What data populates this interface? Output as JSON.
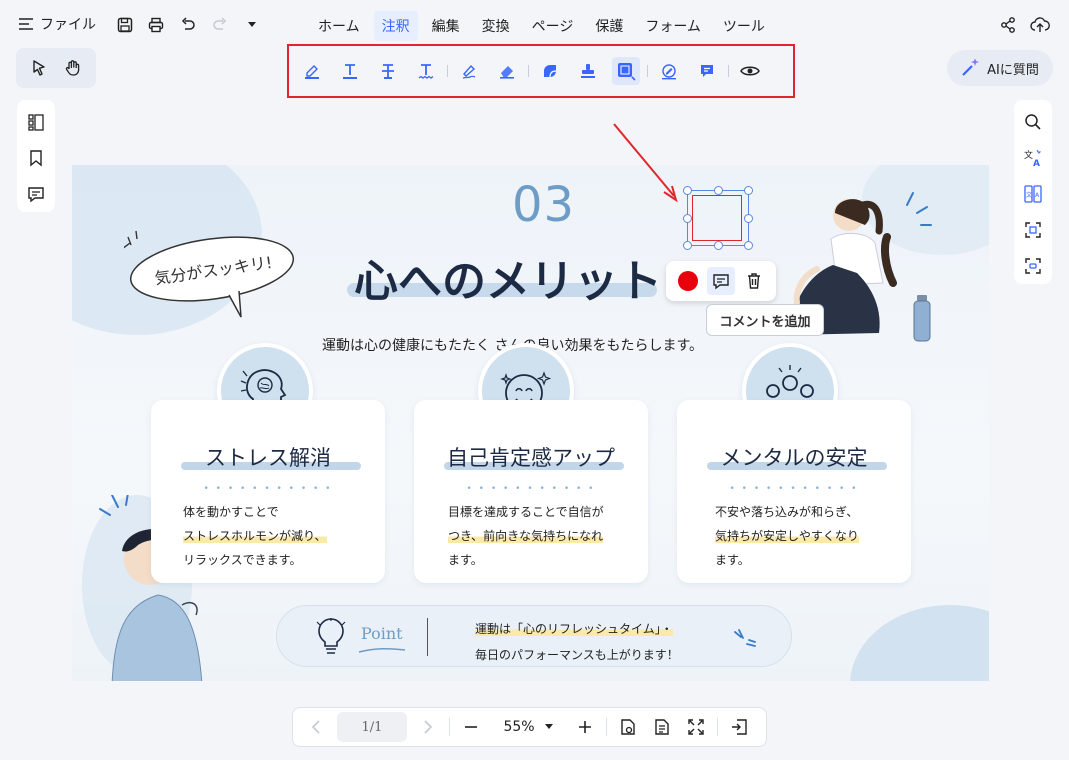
{
  "header": {
    "menu_label": "ファイル",
    "tabs": [
      {
        "label": "ホーム",
        "active": false
      },
      {
        "label": "注釈",
        "active": true
      },
      {
        "label": "編集",
        "active": false
      },
      {
        "label": "変換",
        "active": false
      },
      {
        "label": "ページ",
        "active": false
      },
      {
        "label": "保護",
        "active": false
      },
      {
        "label": "フォーム",
        "active": false
      },
      {
        "label": "ツール",
        "active": false
      }
    ]
  },
  "ai_button": {
    "label": "AIに質問"
  },
  "document": {
    "number": "03",
    "title": "心へのメリット",
    "subtitle": "運動は心の健康にもたたく さんの良い効果をもたらします。",
    "speech_bubble": "気分がスッキリ!",
    "cards": [
      {
        "title": "ストレス解消",
        "dots": "• • • • • • • • • • •",
        "lines": [
          "体を動かすことで",
          "ストレスホルモンが減り、",
          "リラックスできます。"
        ],
        "highlight_line": 1
      },
      {
        "title": "自己肯定感アップ",
        "dots": "• • • • • • • • • • •",
        "lines": [
          "目標を達成することで自信が",
          "つき、前向きな気持ちになれ",
          "ます。"
        ],
        "highlight_line": 1
      },
      {
        "title": "メンタルの安定",
        "dots": "• • • • • • • • • • •",
        "lines": [
          "不安や落ち込みが和らぎ、",
          "気持ちが安定しやすくなり",
          "ます。"
        ],
        "highlight_line": 1
      }
    ],
    "point": {
      "label": "Point",
      "line1": "運動は「心のリフレッシュタイム」・",
      "line2": "毎日のパフォーマンスも上がります！"
    }
  },
  "tooltip": {
    "text": "コメントを追加"
  },
  "footer": {
    "page": "1/1",
    "zoom": "55%"
  },
  "colors": {
    "accent": "#3a66ff",
    "highlight_border": "#e0262d",
    "record": "#e8000c"
  }
}
